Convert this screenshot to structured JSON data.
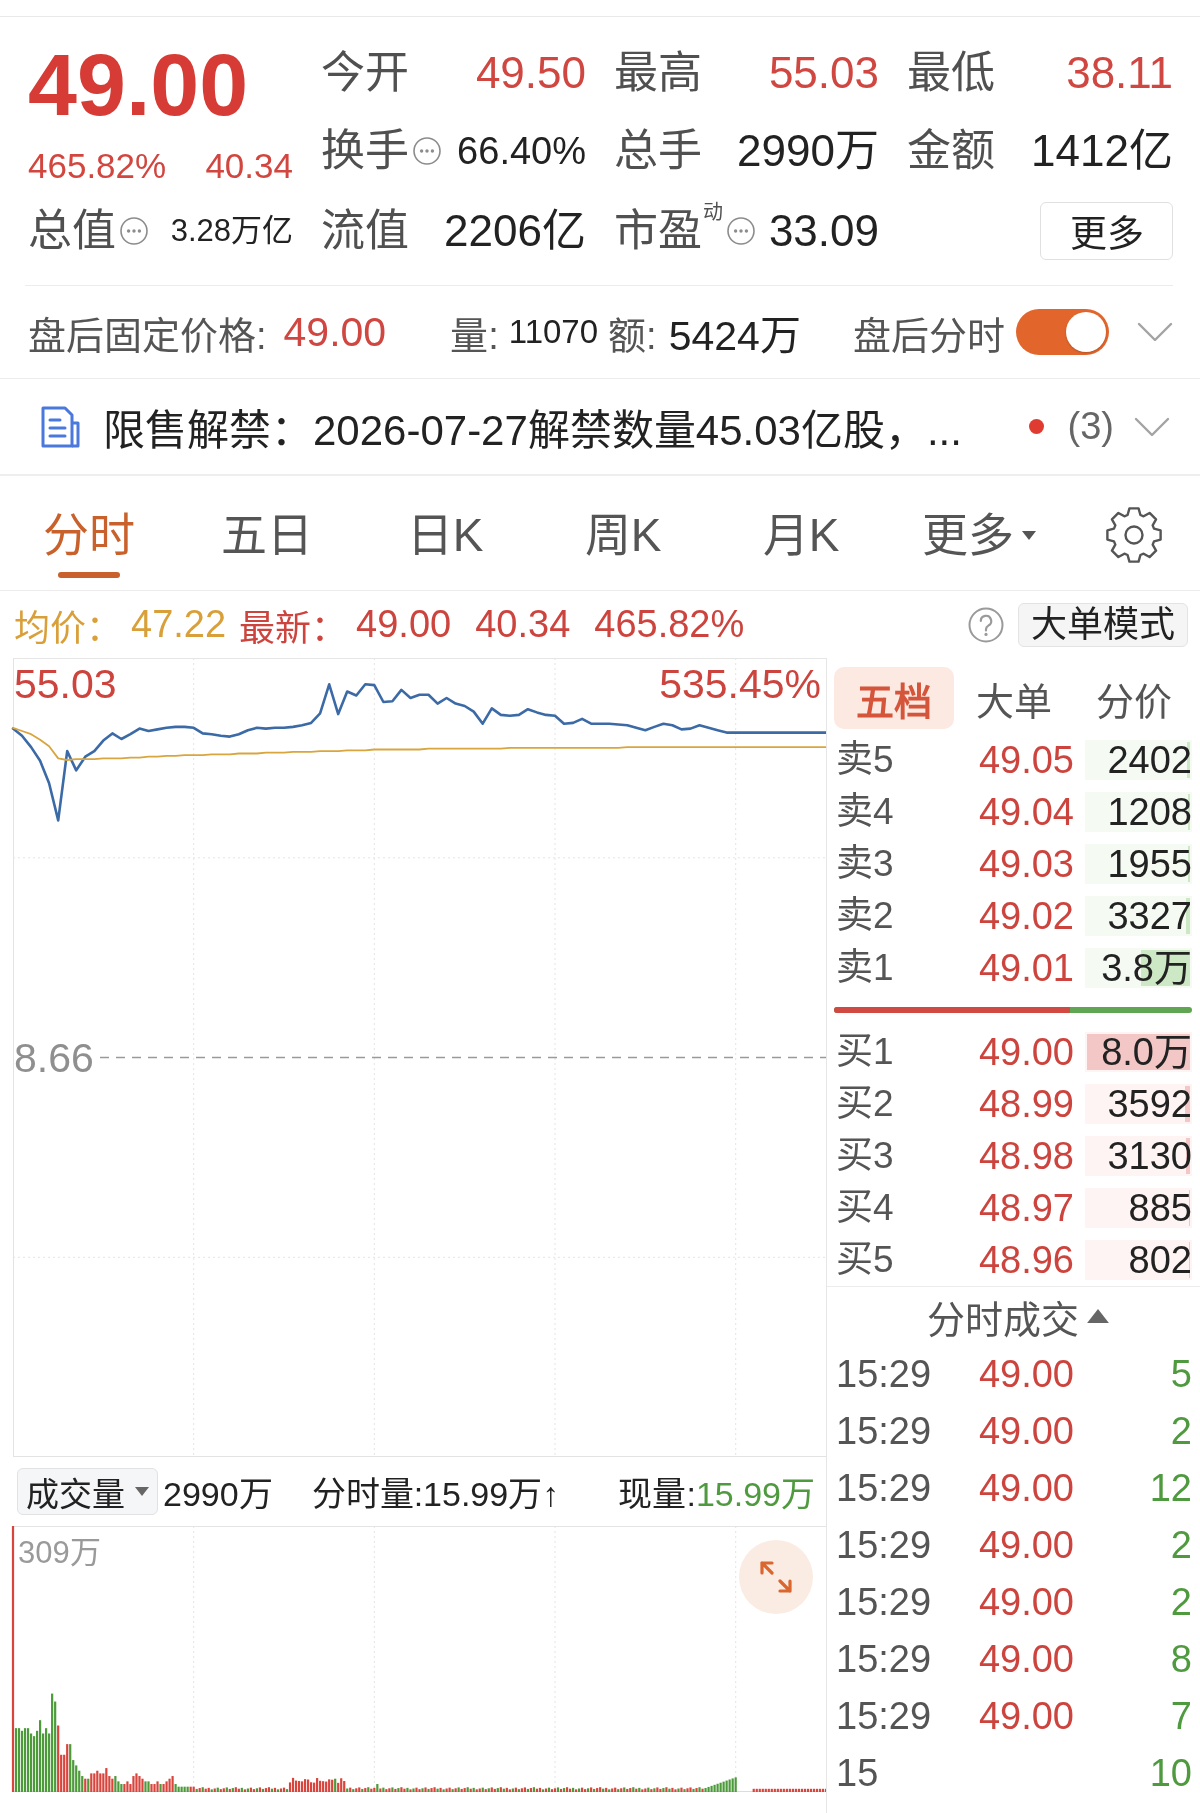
{
  "quote": {
    "price": "49.00",
    "change_pct": "465.82%",
    "change": "40.34",
    "total_value": {
      "label": "总值",
      "info": true,
      "value": "3.28万亿",
      "kind": "tiny"
    }
  },
  "stats": [
    [
      {
        "label": "今开",
        "value": "49.50",
        "kind": "price"
      },
      {
        "label": "最高",
        "value": "55.03",
        "kind": "price"
      },
      {
        "label": "最低",
        "value": "38.11",
        "kind": "price"
      }
    ],
    [
      {
        "label": "换手",
        "value": "66.40%",
        "kind": "small",
        "info": true
      },
      {
        "label": "总手",
        "value": "2990万",
        "kind": "figure"
      },
      {
        "label": "金额",
        "value": "1412亿",
        "kind": "figure"
      }
    ],
    [
      {
        "label": "流值",
        "value": "2206亿",
        "kind": "figure"
      },
      {
        "label": "市盈",
        "superscript": "动",
        "value": "33.09",
        "kind": "figure",
        "info": true
      }
    ]
  ],
  "more_button": "更多",
  "after_hours": {
    "label": "盘后固定价格:",
    "price": "49.00",
    "volume_label": "量:",
    "volume": "11070",
    "amount_label": "额:",
    "amount": "5424万",
    "chart_toggle_label": "盘后分时",
    "chart_toggle_on": true
  },
  "notice": {
    "text": "限售解禁：2026-07-27解禁数量45.03亿股，...",
    "unread": true,
    "count": "(3)"
  },
  "period_tabs": [
    {
      "label": "分时",
      "kind": "tab",
      "selected": true
    },
    {
      "label": "五日",
      "kind": "tab",
      "selected": false
    },
    {
      "label": "日K",
      "kind": "tab",
      "selected": false
    },
    {
      "label": "周K",
      "kind": "tab",
      "selected": false
    },
    {
      "label": "月K",
      "kind": "tab",
      "selected": false
    },
    {
      "label": "更多",
      "kind": "menu",
      "selected": false
    }
  ],
  "summary": {
    "average_label": "均价：",
    "average": "47.22",
    "latest_label": "最新：",
    "latest": "49.00",
    "change": "40.34",
    "change_pct": "465.82%",
    "mode_button": "大单模式"
  },
  "price_chart": {
    "change_label": "535.45%",
    "chart_data": {
      "type": "line",
      "categories": [
        null,
        null,
        null,
        null,
        null,
        null,
        null,
        null,
        null,
        null,
        null,
        null,
        null,
        null,
        null,
        null,
        null,
        null,
        null,
        null,
        null,
        null,
        null,
        null,
        null,
        null,
        null,
        null,
        null,
        null,
        null,
        null,
        null,
        null,
        null,
        null,
        null,
        null,
        null,
        null,
        null,
        null,
        null,
        null,
        null,
        null,
        null,
        null,
        null,
        null,
        null,
        null,
        null,
        null,
        null,
        null,
        null,
        null,
        null,
        null,
        null,
        null,
        null,
        null,
        null,
        null,
        null,
        null,
        null,
        null,
        null,
        null,
        null,
        null,
        null,
        null,
        null,
        null,
        null,
        null,
        null,
        null,
        null,
        null,
        null,
        null,
        null,
        null,
        null,
        null,
        null
      ],
      "series": [
        {
          "color": "#3b6aa6",
          "values": [
            49.5,
            48.6,
            47.2,
            45.5,
            42.7,
            38.1,
            46.7,
            44.3,
            46.0,
            46.7,
            48.0,
            48.9,
            48.2,
            48.8,
            49.5,
            49.2,
            49.4,
            49.6,
            49.7,
            49.7,
            49.6,
            48.9,
            48.8,
            48.6,
            48.5,
            48.8,
            49.3,
            49.6,
            49.5,
            49.6,
            49.6,
            49.7,
            49.9,
            50.2,
            51.4,
            55.0,
            51.3,
            54.1,
            53.6,
            55.0,
            54.9,
            52.8,
            52.9,
            54.3,
            53.3,
            53.7,
            53.7,
            52.6,
            53.3,
            52.6,
            52.3,
            51.6,
            50.1,
            52.0,
            51.2,
            51.1,
            51.2,
            51.9,
            51.5,
            51.2,
            51.1,
            50.1,
            50.2,
            50.7,
            50.1,
            50.1,
            50.1,
            50.0,
            49.9,
            49.6,
            49.3,
            49.7,
            50.1,
            49.9,
            49.4,
            49.5,
            49.9,
            49.6,
            49.3,
            49.0,
            49.0,
            49.0,
            49.0,
            49.0,
            49.0,
            49.0,
            49.0,
            49.0,
            49.0,
            49.0,
            49.0
          ]
        },
        {
          "color": "#d9a53e",
          "values": [
            49.6,
            49.2,
            48.8,
            48.1,
            47.3,
            45.8,
            45.6,
            45.7,
            45.7,
            45.7,
            45.8,
            45.8,
            45.8,
            45.9,
            45.9,
            46.0,
            46.0,
            46.1,
            46.1,
            46.2,
            46.2,
            46.2,
            46.3,
            46.3,
            46.3,
            46.4,
            46.4,
            46.4,
            46.5,
            46.5,
            46.5,
            46.6,
            46.6,
            46.6,
            46.7,
            46.7,
            46.7,
            46.8,
            46.8,
            46.8,
            46.9,
            46.9,
            46.9,
            46.9,
            46.9,
            46.9,
            47.0,
            47.0,
            47.0,
            47.0,
            47.0,
            47.0,
            47.0,
            47.0,
            47.0,
            47.1,
            47.1,
            47.1,
            47.1,
            47.1,
            47.1,
            47.1,
            47.1,
            47.1,
            47.1,
            47.1,
            47.1,
            47.1,
            47.2,
            47.2,
            47.2,
            47.2,
            47.2,
            47.2,
            47.2,
            47.2,
            47.2,
            47.2,
            47.2,
            47.2,
            47.2,
            47.2,
            47.2,
            47.2,
            47.2,
            47.2,
            47.2,
            47.2,
            47.2,
            47.2,
            47.2
          ]
        }
      ],
      "ylim": [
        -40.94,
        58.26
      ],
      "yticks": [
        {
          "value": 55.03,
          "label": "55.03"
        },
        {
          "value": 8.66,
          "label": "8.66"
        }
      ],
      "grid": true,
      "ref_lines": [
        {
          "axis": "y",
          "value": 8.66
        }
      ]
    }
  },
  "volume_panel": {
    "selector": "成交量",
    "total": "2990万",
    "minute_volume": "分时量:15.99万↑",
    "current_label": "现量:",
    "current": "15.99万",
    "scale_label": "309万"
  },
  "order_book": {
    "tabs": [
      {
        "label": "五档",
        "selected": true
      },
      {
        "label": "大单",
        "selected": false
      },
      {
        "label": "分价",
        "selected": false
      }
    ],
    "asks": [
      {
        "label": "卖5",
        "price": "49.05",
        "volume": "2402",
        "level": 0.03
      },
      {
        "label": "卖4",
        "price": "49.04",
        "volume": "1208",
        "level": 0.015
      },
      {
        "label": "卖3",
        "price": "49.03",
        "volume": "1955",
        "level": 0.024
      },
      {
        "label": "卖2",
        "price": "49.02",
        "volume": "3327",
        "level": 0.042
      },
      {
        "label": "卖1",
        "price": "49.01",
        "volume": "3.8万",
        "level": 0.475
      }
    ],
    "ratio": {
      "level": 0.66
    },
    "bids": [
      {
        "label": "买1",
        "price": "49.00",
        "volume": "8.0万",
        "level": 1.0
      },
      {
        "label": "买2",
        "price": "48.99",
        "volume": "3592",
        "level": 0.045
      },
      {
        "label": "买3",
        "price": "48.98",
        "volume": "3130",
        "level": 0.039
      },
      {
        "label": "买4",
        "price": "48.97",
        "volume": "885",
        "level": 0.011
      },
      {
        "label": "买5",
        "price": "48.96",
        "volume": "802",
        "level": 0.01
      }
    ]
  },
  "trades": {
    "title": "分时成交",
    "rows": [
      {
        "time": "15:29",
        "price": "49.00",
        "volume": "5",
        "kind": "sell"
      },
      {
        "time": "15:29",
        "price": "49.00",
        "volume": "2",
        "kind": "sell"
      },
      {
        "time": "15:29",
        "price": "49.00",
        "volume": "12",
        "kind": "sell"
      },
      {
        "time": "15:29",
        "price": "49.00",
        "volume": "2",
        "kind": "sell"
      },
      {
        "time": "15:29",
        "price": "49.00",
        "volume": "2",
        "kind": "sell"
      },
      {
        "time": "15:29",
        "price": "49.00",
        "volume": "8",
        "kind": "sell"
      },
      {
        "time": "15:29",
        "price": "49.00",
        "volume": "7",
        "kind": "sell"
      },
      {
        "time": "15",
        "volume": "10",
        "kind": "sell"
      }
    ]
  }
}
